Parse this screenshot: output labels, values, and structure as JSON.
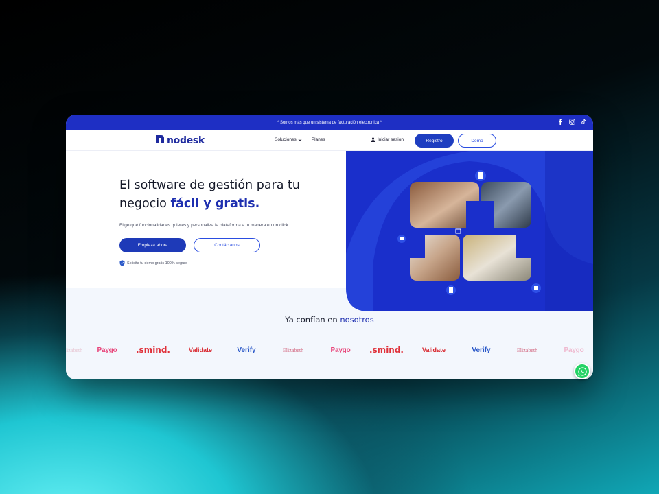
{
  "colors": {
    "primary": "#1e2fc4",
    "accent_text": "#1e2fb0",
    "paygo": "#e8457a",
    "smind": "#e0313a",
    "validate": "#d8242b",
    "verify": "#2a58c8",
    "elizabeth": "#d2667f",
    "whatsapp": "#25d366"
  },
  "topbar": {
    "announcement": "* Somos más que un sistema de facturación electronica *",
    "socials": [
      "facebook-icon",
      "instagram-icon",
      "tiktok-icon"
    ]
  },
  "nav": {
    "logo_text": "nodesk",
    "links": [
      "Soluciones",
      "Planes"
    ],
    "login": "Iniciar sesion",
    "register": "Registro",
    "demo": "Demo"
  },
  "hero": {
    "title_line1": "El software de gestión para tu",
    "title_line2_prefix": "negocio ",
    "title_line2_accent": "fácil y gratis.",
    "subtitle": "Elige qué funcionalidades quieres y personaliza la plataforma a tu manera en un click.",
    "cta_primary": "Empieza ahora",
    "cta_secondary": "Contáctanos",
    "secure_note": "Solicita tu demo gratis 100% seguro"
  },
  "trust": {
    "title_prefix": "Ya confían en ",
    "title_accent": "nosotros",
    "logos": [
      {
        "text": "Elizabeth",
        "faded": true
      },
      {
        "text": "Paygo"
      },
      {
        "text": ".smind."
      },
      {
        "text": "Validate"
      },
      {
        "text": "Verify"
      },
      {
        "text": "Elizabeth"
      },
      {
        "text": "Paygo"
      },
      {
        "text": ".smind."
      },
      {
        "text": "Validate"
      },
      {
        "text": "Verify"
      },
      {
        "text": "Elizabeth"
      },
      {
        "text": "Paygo",
        "faded": true
      }
    ]
  },
  "widgets": {
    "whatsapp_icon": "whatsapp-icon"
  }
}
